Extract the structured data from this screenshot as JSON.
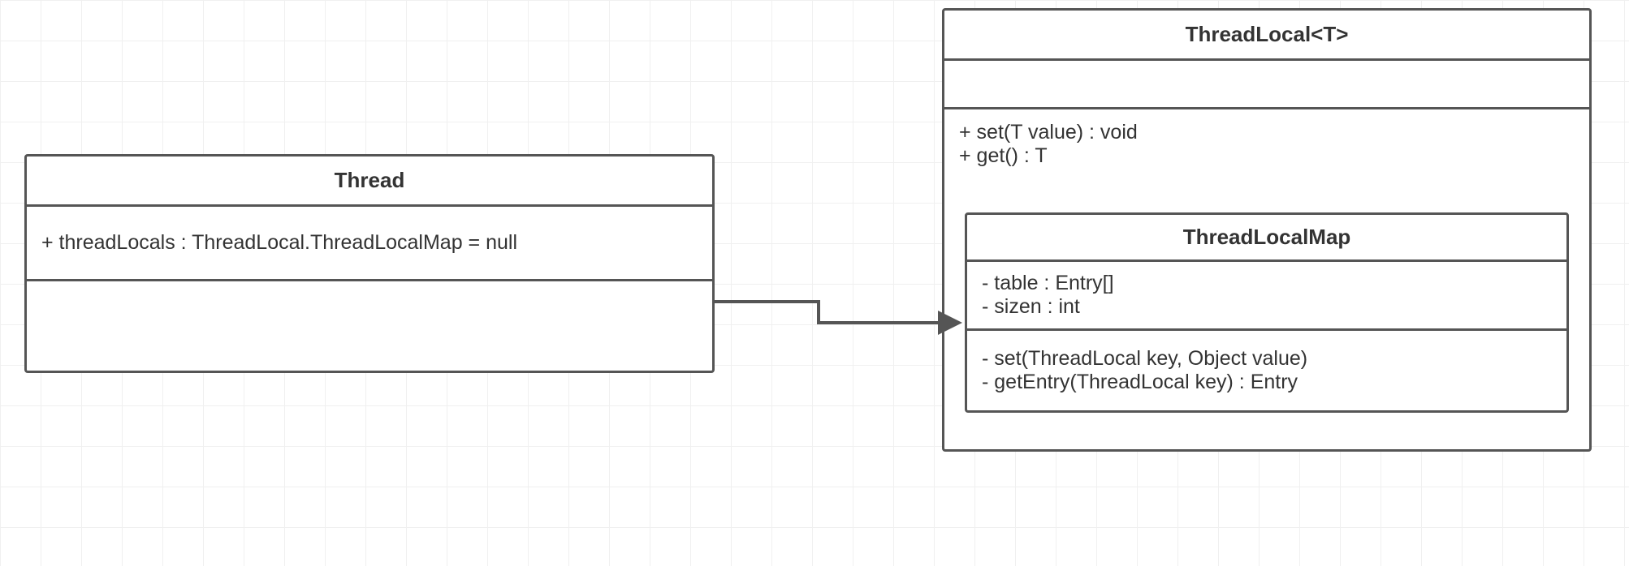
{
  "thread": {
    "title": "Thread",
    "attributes": "+ threadLocals : ThreadLocal.ThreadLocalMap = null"
  },
  "threadLocal": {
    "title": "ThreadLocal<T>",
    "methods_line1": "+ set(T value) : void",
    "methods_line2": "+ get() : T"
  },
  "threadLocalMap": {
    "title": "ThreadLocalMap",
    "attr_line1": "- table : Entry[]",
    "attr_line2": "- sizen : int",
    "method_line1": "- set(ThreadLocal key, Object value)",
    "method_line2": "- getEntry(ThreadLocal key) :  Entry"
  }
}
